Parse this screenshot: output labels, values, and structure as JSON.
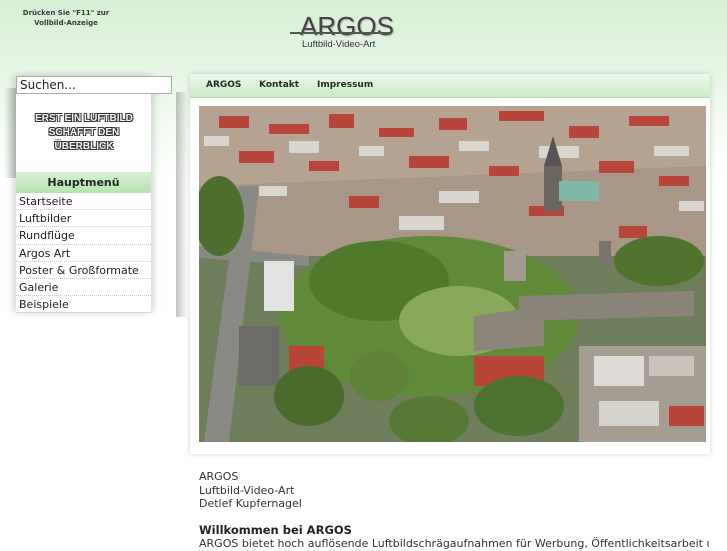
{
  "header": {
    "f11_hint_line1": "Drücken Sie \"F11\" zur",
    "f11_hint_line2": "Vollbild-Anzeige",
    "logo_title": "ARGOS",
    "logo_subtitle": "Luftbild-Video-Art"
  },
  "search": {
    "placeholder": "Suchen..."
  },
  "sidebar": {
    "slogan_line1": "ERST EIN LUFTBILD",
    "slogan_line2": "SCHAFFT DEN",
    "slogan_line3": "ÜBERBLICK",
    "menu_heading": "Hauptmenü",
    "items": [
      {
        "label": "Startseite"
      },
      {
        "label": "Luftbilder"
      },
      {
        "label": "Rundflüge"
      },
      {
        "label": "Argos Art"
      },
      {
        "label": "Poster & Großformate"
      },
      {
        "label": "Galerie"
      },
      {
        "label": "Beispiele"
      }
    ]
  },
  "nav": {
    "items": [
      {
        "label": "ARGOS"
      },
      {
        "label": "Kontakt"
      },
      {
        "label": "Impressum"
      }
    ]
  },
  "main": {
    "address_line1": "ARGOS",
    "address_line2": "Luftbild-Video-Art",
    "address_line3": "Detlef Kupfernagel",
    "welcome_heading": "Willkommen bei ARGOS",
    "intro_text": "ARGOS bietet hoch auflösende Luftbildschrägaufnahmen für Werbung, Öffentlichkeitsarbeit und"
  },
  "colors": {
    "accent_green": "#b6e3b0",
    "header_band": "#d6f0d4"
  }
}
